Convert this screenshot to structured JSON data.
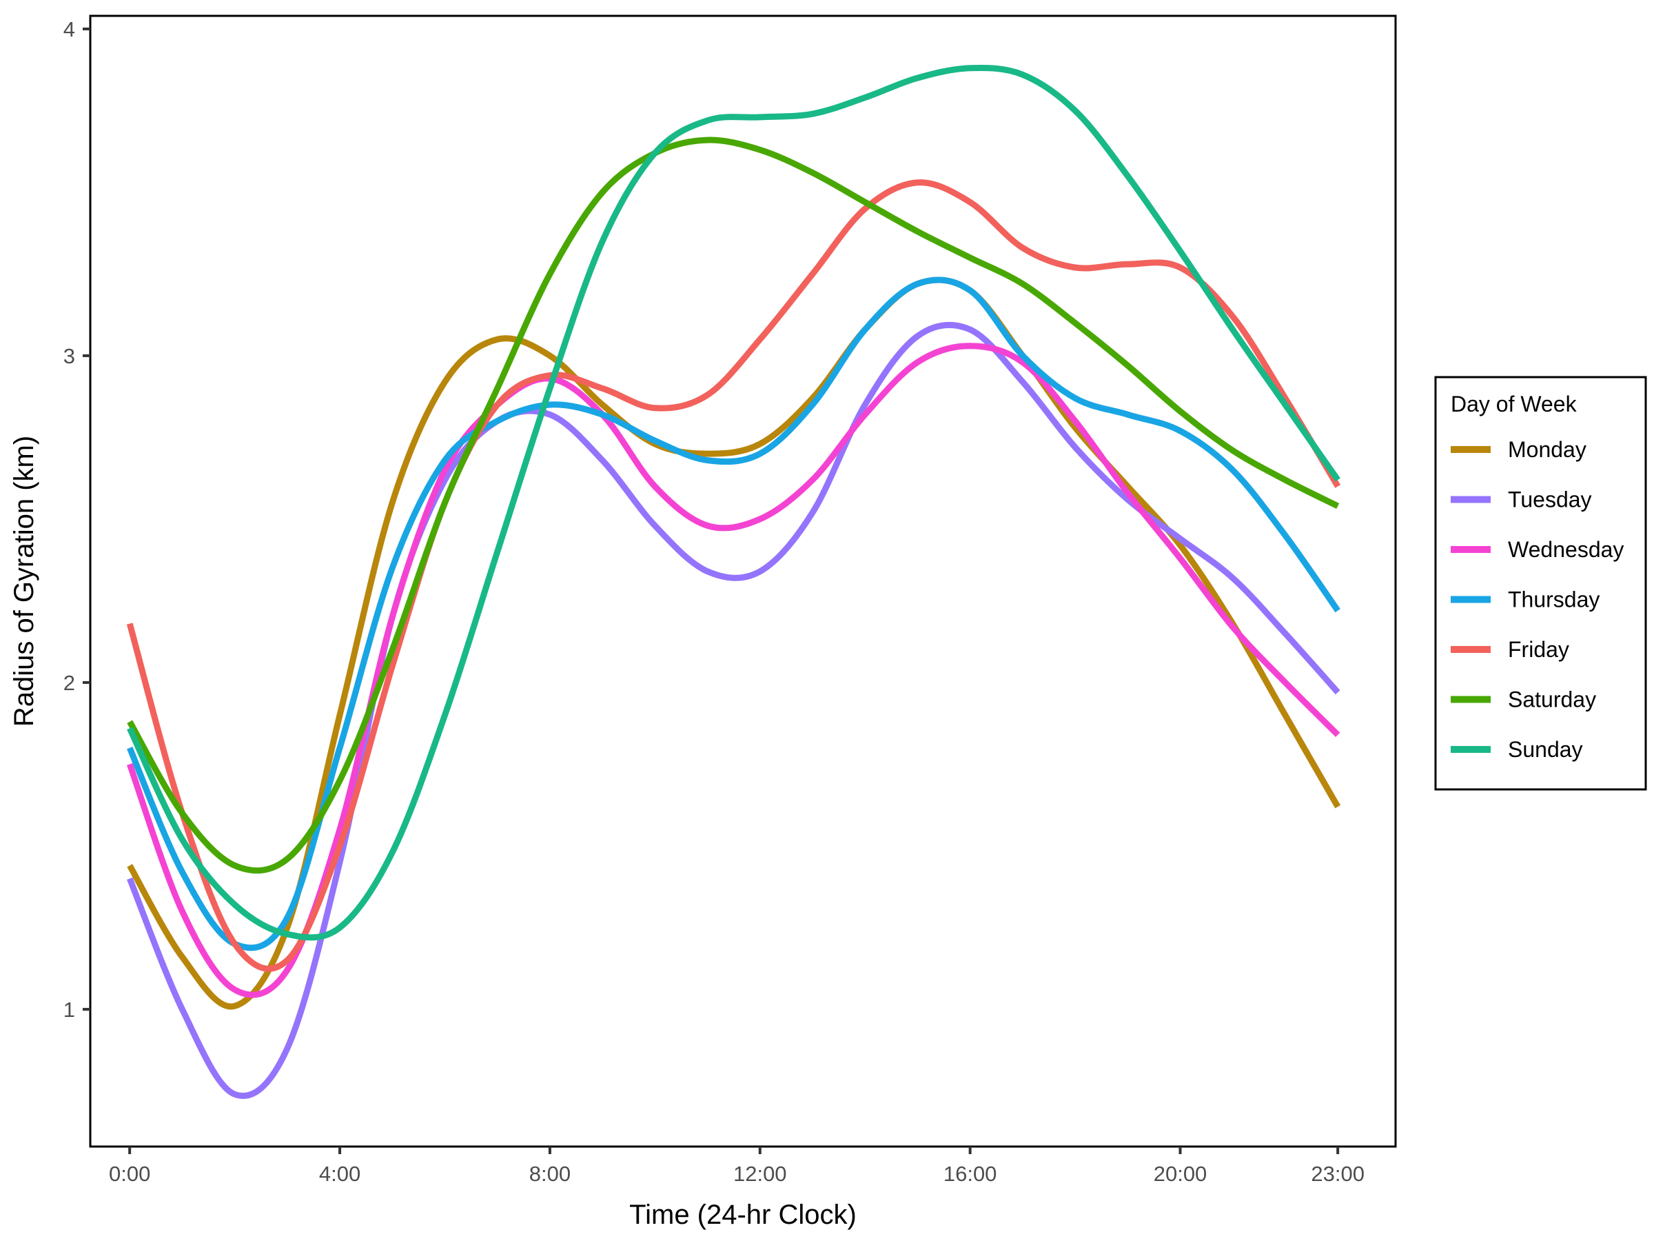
{
  "chart_data": {
    "type": "line",
    "title": "",
    "xlabel": "Time (24-hr Clock)",
    "ylabel": "Radius of Gyration (km)",
    "x": [
      0,
      1,
      2,
      3,
      4,
      5,
      6,
      7,
      8,
      9,
      10,
      11,
      12,
      13,
      14,
      15,
      16,
      17,
      18,
      19,
      20,
      21,
      22,
      23
    ],
    "xlim": [
      -0.75,
      24.1
    ],
    "ylim": [
      0.58,
      4.04
    ],
    "x_ticks": [
      {
        "value": 0,
        "label": "0:00"
      },
      {
        "value": 4,
        "label": "4:00"
      },
      {
        "value": 8,
        "label": "8:00"
      },
      {
        "value": 12,
        "label": "12:00"
      },
      {
        "value": 16,
        "label": "16:00"
      },
      {
        "value": 20,
        "label": "20:00"
      },
      {
        "value": 23,
        "label": "23:00"
      }
    ],
    "y_ticks": [
      {
        "value": 1,
        "label": "1"
      },
      {
        "value": 2,
        "label": "2"
      },
      {
        "value": 3,
        "label": "3"
      },
      {
        "value": 4,
        "label": "4"
      }
    ],
    "grid": false,
    "legend": {
      "title": "Day of Week",
      "placement": "right"
    },
    "series": [
      {
        "name": "Monday",
        "color": "#b8860b",
        "values": [
          1.44,
          1.16,
          1.01,
          1.25,
          1.9,
          2.55,
          2.92,
          3.05,
          3.0,
          2.85,
          2.73,
          2.7,
          2.73,
          2.87,
          3.08,
          3.22,
          3.2,
          3.0,
          2.78,
          2.6,
          2.42,
          2.18,
          1.9,
          1.62
        ]
      },
      {
        "name": "Tuesday",
        "color": "#9474fc",
        "values": [
          1.4,
          1.0,
          0.74,
          0.88,
          1.45,
          2.2,
          2.62,
          2.8,
          2.82,
          2.68,
          2.48,
          2.34,
          2.34,
          2.52,
          2.85,
          3.06,
          3.08,
          2.92,
          2.72,
          2.56,
          2.44,
          2.32,
          2.15,
          1.97
        ]
      },
      {
        "name": "Wednesday",
        "color": "#f443d3",
        "values": [
          1.75,
          1.3,
          1.06,
          1.12,
          1.55,
          2.2,
          2.65,
          2.85,
          2.93,
          2.82,
          2.6,
          2.48,
          2.5,
          2.62,
          2.82,
          2.98,
          3.03,
          2.98,
          2.8,
          2.58,
          2.38,
          2.17,
          2.0,
          1.84
        ]
      },
      {
        "name": "Thursday",
        "color": "#19a5e4",
        "values": [
          1.8,
          1.42,
          1.2,
          1.28,
          1.8,
          2.35,
          2.68,
          2.8,
          2.85,
          2.82,
          2.74,
          2.68,
          2.7,
          2.85,
          3.08,
          3.22,
          3.2,
          3.0,
          2.87,
          2.82,
          2.77,
          2.65,
          2.45,
          2.22
        ]
      },
      {
        "name": "Friday",
        "color": "#f2615c",
        "values": [
          2.18,
          1.6,
          1.2,
          1.15,
          1.5,
          2.05,
          2.55,
          2.85,
          2.94,
          2.9,
          2.84,
          2.88,
          3.05,
          3.25,
          3.45,
          3.53,
          3.47,
          3.33,
          3.27,
          3.28,
          3.27,
          3.12,
          2.87,
          2.6
        ]
      },
      {
        "name": "Saturday",
        "color": "#49a703",
        "values": [
          1.88,
          1.6,
          1.44,
          1.46,
          1.7,
          2.1,
          2.55,
          2.9,
          3.25,
          3.5,
          3.62,
          3.66,
          3.63,
          3.56,
          3.47,
          3.38,
          3.3,
          3.22,
          3.1,
          2.97,
          2.83,
          2.71,
          2.62,
          2.54
        ]
      },
      {
        "name": "Sunday",
        "color": "#19b887",
        "values": [
          1.86,
          1.52,
          1.32,
          1.23,
          1.25,
          1.48,
          1.9,
          2.4,
          2.9,
          3.35,
          3.62,
          3.72,
          3.73,
          3.74,
          3.79,
          3.85,
          3.88,
          3.86,
          3.75,
          3.55,
          3.32,
          3.08,
          2.85,
          2.62
        ]
      }
    ]
  }
}
